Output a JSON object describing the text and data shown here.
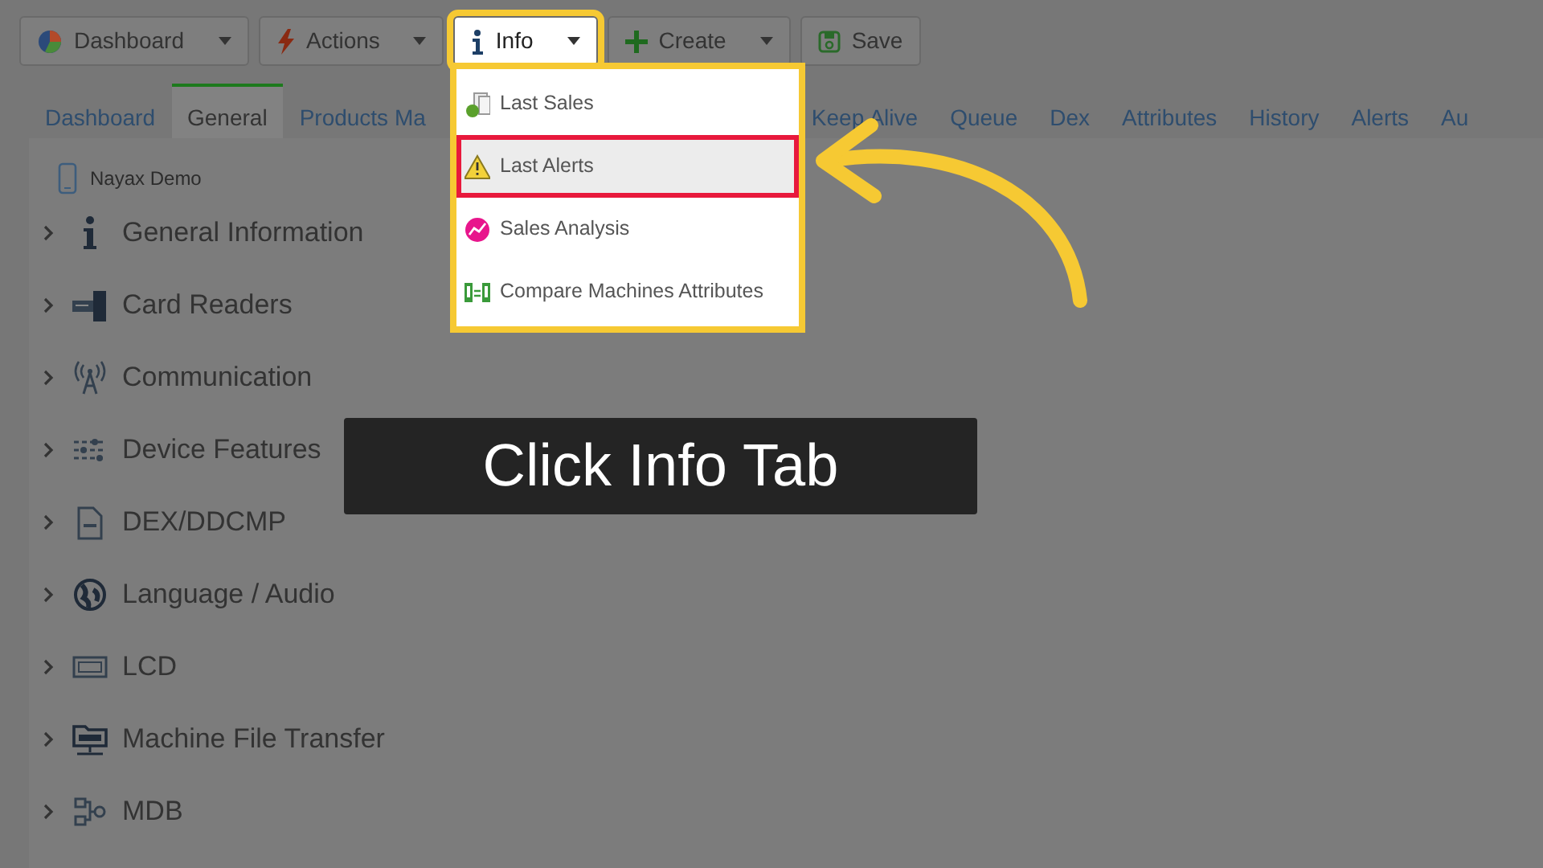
{
  "toolbar": [
    {
      "label": "Dashboard",
      "kind": "pie",
      "caret": true,
      "highlighted": false
    },
    {
      "label": "Actions",
      "kind": "bolt",
      "caret": true,
      "highlighted": false
    },
    {
      "label": "Info",
      "kind": "info",
      "caret": true,
      "highlighted": true
    },
    {
      "label": "Create",
      "kind": "plus",
      "caret": true,
      "highlighted": false
    },
    {
      "label": "Save",
      "kind": "save",
      "caret": false,
      "highlighted": false
    }
  ],
  "info_menu": [
    {
      "label": "Last Sales",
      "kind": "sales",
      "highlighted": false
    },
    {
      "label": "Last Alerts",
      "kind": "warning",
      "highlighted": true
    },
    {
      "label": "Sales Analysis",
      "kind": "analysis",
      "highlighted": false
    },
    {
      "label": "Compare Machines Attributes",
      "kind": "compare",
      "highlighted": false
    }
  ],
  "tabs": [
    {
      "label": "Dashboard",
      "selected": false
    },
    {
      "label": "General",
      "selected": true
    },
    {
      "label": "Products Ma",
      "selected": false
    },
    {
      "label": "Keep Alive",
      "selected": false
    },
    {
      "label": "Queue",
      "selected": false
    },
    {
      "label": "Dex",
      "selected": false
    },
    {
      "label": "Attributes",
      "selected": false
    },
    {
      "label": "History",
      "selected": false
    },
    {
      "label": "Alerts",
      "selected": false
    },
    {
      "label": "Au",
      "selected": false
    }
  ],
  "device": {
    "name": "Nayax Demo"
  },
  "sections": [
    {
      "label": "General Information",
      "kind": "info",
      "expanded": false
    },
    {
      "label": "Card Readers",
      "kind": "card",
      "expanded": false
    },
    {
      "label": "Communication",
      "kind": "antenna",
      "expanded": false
    },
    {
      "label": "Device Features",
      "kind": "sliders",
      "expanded": false
    },
    {
      "label": "DEX/DDCMP",
      "kind": "dex",
      "expanded": false
    },
    {
      "label": "Language / Audio",
      "kind": "globe",
      "expanded": false
    },
    {
      "label": "LCD",
      "kind": "lcd",
      "expanded": false
    },
    {
      "label": "Machine File Transfer",
      "kind": "ftp",
      "expanded": false
    },
    {
      "label": "MDB",
      "kind": "mdb",
      "expanded": false
    }
  ],
  "caption": "Click Info Tab"
}
